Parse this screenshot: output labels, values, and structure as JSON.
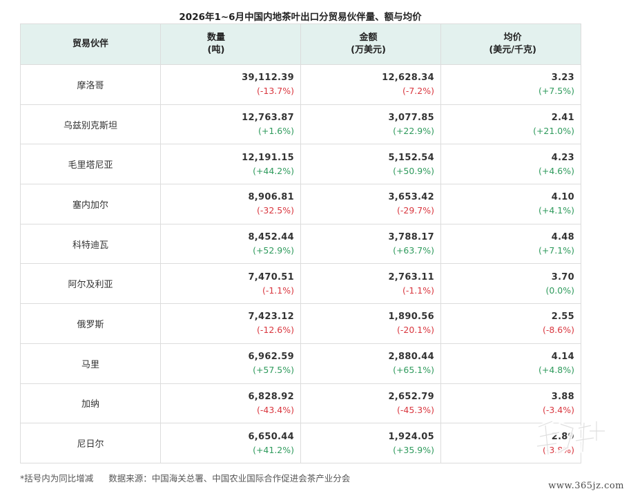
{
  "title": "2026年1~6月中国内地茶叶出口分贸易伙伴量、额与均价",
  "headers": {
    "partner": "贸易伙伴",
    "qty_line1": "数量",
    "qty_line2": "(吨)",
    "amt_line1": "金额",
    "amt_line2": "(万美元)",
    "avg_line1": "均价",
    "avg_line2": "(美元/千克)"
  },
  "rows": [
    {
      "partner": "摩洛哥",
      "qty": "39,112.39",
      "qty_chg": "(-13.7%)",
      "amt": "12,628.34",
      "amt_chg": "(-7.2%)",
      "avg": "3.23",
      "avg_chg": "(+7.5%)"
    },
    {
      "partner": "乌兹别克斯坦",
      "qty": "12,763.87",
      "qty_chg": "(+1.6%)",
      "amt": "3,077.85",
      "amt_chg": "(+22.9%)",
      "avg": "2.41",
      "avg_chg": "(+21.0%)"
    },
    {
      "partner": "毛里塔尼亚",
      "qty": "12,191.15",
      "qty_chg": "(+44.2%)",
      "amt": "5,152.54",
      "amt_chg": "(+50.9%)",
      "avg": "4.23",
      "avg_chg": "(+4.6%)"
    },
    {
      "partner": "塞内加尔",
      "qty": "8,906.81",
      "qty_chg": "(-32.5%)",
      "amt": "3,653.42",
      "amt_chg": "(-29.7%)",
      "avg": "4.10",
      "avg_chg": "(+4.1%)"
    },
    {
      "partner": "科特迪瓦",
      "qty": "8,452.44",
      "qty_chg": "(+52.9%)",
      "amt": "3,788.17",
      "amt_chg": "(+63.7%)",
      "avg": "4.48",
      "avg_chg": "(+7.1%)"
    },
    {
      "partner": "阿尔及利亚",
      "qty": "7,470.51",
      "qty_chg": "(-1.1%)",
      "amt": "2,763.11",
      "amt_chg": "(-1.1%)",
      "avg": "3.70",
      "avg_chg": "(0.0%)"
    },
    {
      "partner": "俄罗斯",
      "qty": "7,423.12",
      "qty_chg": "(-12.6%)",
      "amt": "1,890.56",
      "amt_chg": "(-20.1%)",
      "avg": "2.55",
      "avg_chg": "(-8.6%)"
    },
    {
      "partner": "马里",
      "qty": "6,962.59",
      "qty_chg": "(+57.5%)",
      "amt": "2,880.44",
      "amt_chg": "(+65.1%)",
      "avg": "4.14",
      "avg_chg": "(+4.8%)"
    },
    {
      "partner": "加纳",
      "qty": "6,828.92",
      "qty_chg": "(-43.4%)",
      "amt": "2,652.79",
      "amt_chg": "(-45.3%)",
      "avg": "3.88",
      "avg_chg": "(-3.4%)"
    },
    {
      "partner": "尼日尔",
      "qty": "6,650.44",
      "qty_chg": "(+41.2%)",
      "amt": "1,924.05",
      "amt_chg": "(+35.9%)",
      "avg": "2.89",
      "avg_chg": "(-3.8%)"
    }
  ],
  "footer": {
    "note": "*括号内为同比增减",
    "source": "数据来源：中国海关总署、中国农业国际合作促进会茶产业分会"
  },
  "watermark_site": "www.365jz.com",
  "colors": {
    "header_bg": "#e3f1ee",
    "negative": "#d9363e",
    "positive": "#2e9a5c",
    "border": "#dcdcdc"
  }
}
